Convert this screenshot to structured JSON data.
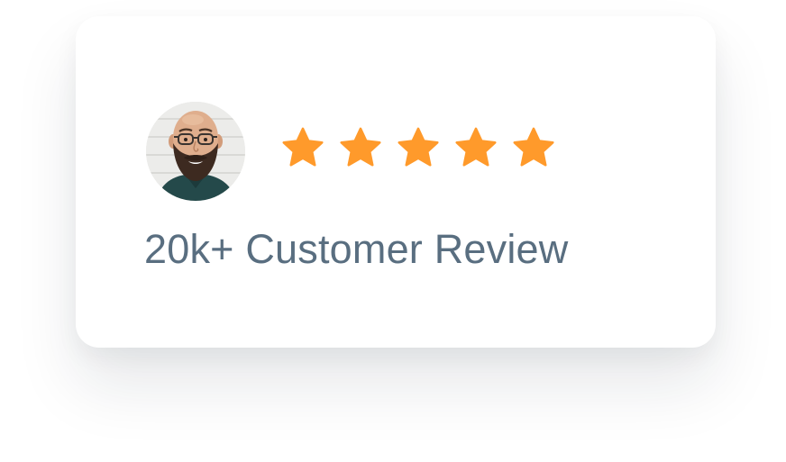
{
  "review": {
    "headline": "20k+ Customer Review",
    "rating": {
      "value": 5,
      "max": 5
    },
    "avatar": {
      "icon": "customer-avatar"
    }
  },
  "colors": {
    "star": "#ff9a2b",
    "headline": "#596e80",
    "card": "#ffffff",
    "shirt": "#24494a",
    "beard": "#3d2a20"
  }
}
